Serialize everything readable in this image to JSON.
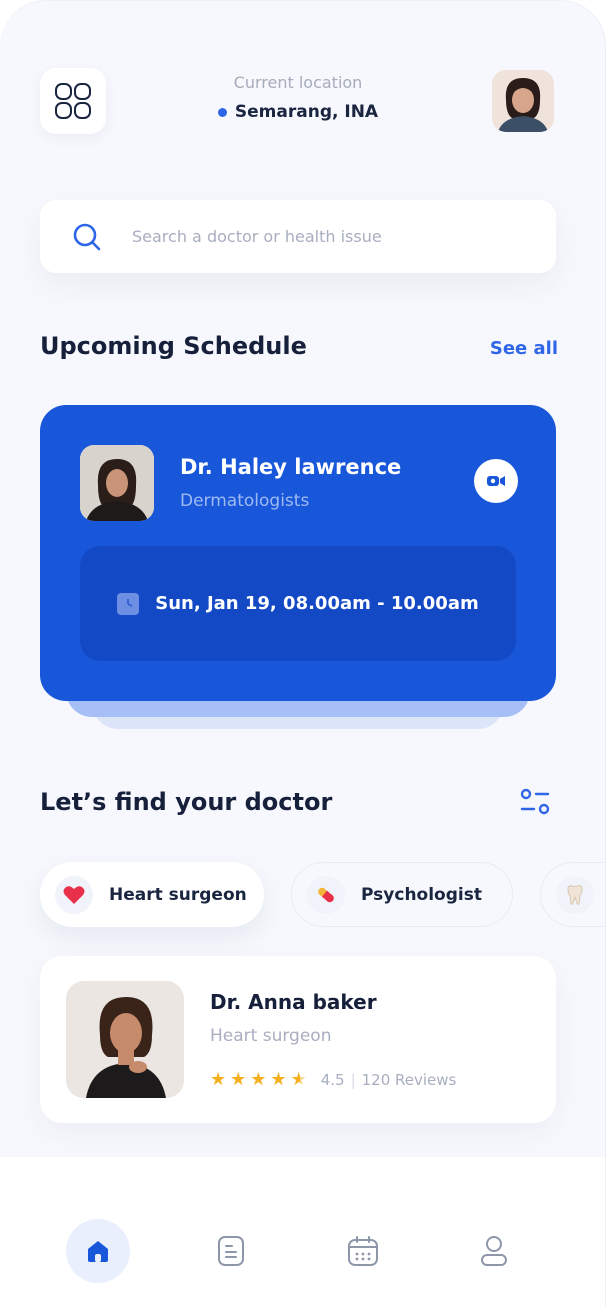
{
  "header": {
    "location_label": "Current location",
    "location_value": "Semarang, INA"
  },
  "search": {
    "placeholder": "Search a doctor or health issue"
  },
  "schedule": {
    "title": "Upcoming Schedule",
    "see_all": "See all",
    "doctor_name": "Dr. Haley lawrence",
    "specialty": "Dermatologists",
    "datetime": "Sun, Jan 19, 08.00am - 10.00am"
  },
  "find": {
    "title": "Let’s find your doctor",
    "chips": [
      {
        "label": "Heart surgeon",
        "icon": "heart-icon"
      },
      {
        "label": "Psychologist",
        "icon": "pill-icon"
      },
      {
        "label": "",
        "icon": "tooth-icon"
      }
    ]
  },
  "doctor": {
    "name": "Dr. Anna baker",
    "specialty": "Heart surgeon",
    "rating": "4.5",
    "reviews": "120 Reviews",
    "stars": 4.5
  },
  "nav": [
    {
      "icon": "home-icon",
      "active": true
    },
    {
      "icon": "document-icon",
      "active": false
    },
    {
      "icon": "calendar-icon",
      "active": false
    },
    {
      "icon": "profile-icon",
      "active": false
    }
  ],
  "colors": {
    "accent": "#2f66e8",
    "card_blue": "#1857d9",
    "star": "#f6b01e",
    "heart": "#e8304a"
  }
}
